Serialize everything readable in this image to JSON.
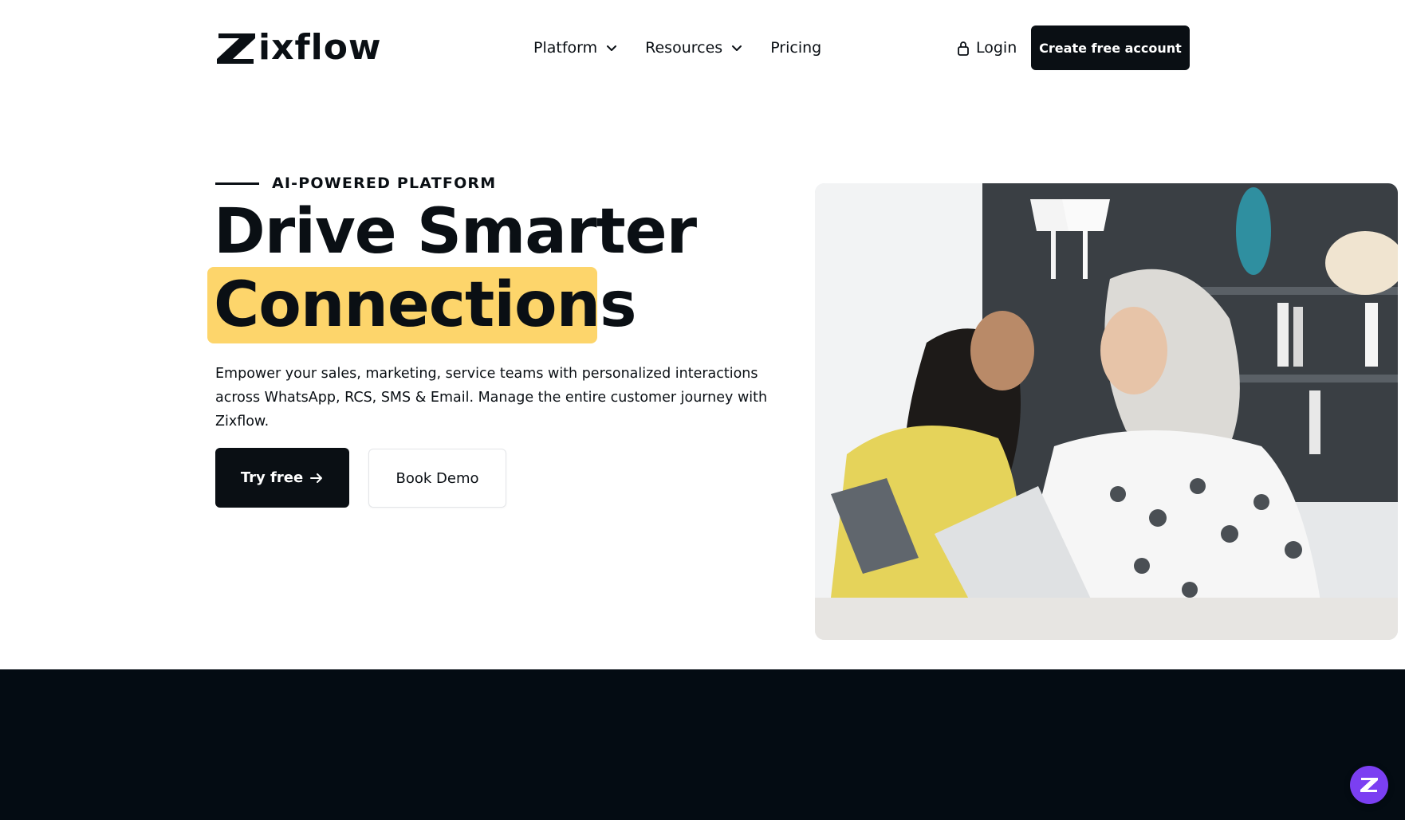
{
  "header": {
    "logo_text": "ixflow",
    "nav": [
      {
        "label": "Platform",
        "has_dropdown": true
      },
      {
        "label": "Resources",
        "has_dropdown": true
      },
      {
        "label": "Pricing",
        "has_dropdown": false
      }
    ],
    "login_label": "Login",
    "create_account_label": "Create free account"
  },
  "hero": {
    "eyebrow": "AI-POWERED PLATFORM",
    "headline_line1": "Drive Smarter",
    "headline_line2": "Connections",
    "subtitle": "Empower your sales, marketing, service teams with personalized interactions across WhatsApp, RCS, SMS & Email. Manage the entire customer journey with Zixflow.",
    "try_free_label": "Try free",
    "book_demo_label": "Book Demo"
  },
  "colors": {
    "primary_dark": "#0a0f14",
    "highlight_yellow": "#fdd56b",
    "dark_section": "#040c13",
    "chat_purple": "#7b3ff2"
  },
  "icons": {
    "nav_dropdown": "chevron-down-icon",
    "login": "lock-icon",
    "try_free": "arrow-right-icon",
    "chat": "zixflow-chat-icon"
  }
}
